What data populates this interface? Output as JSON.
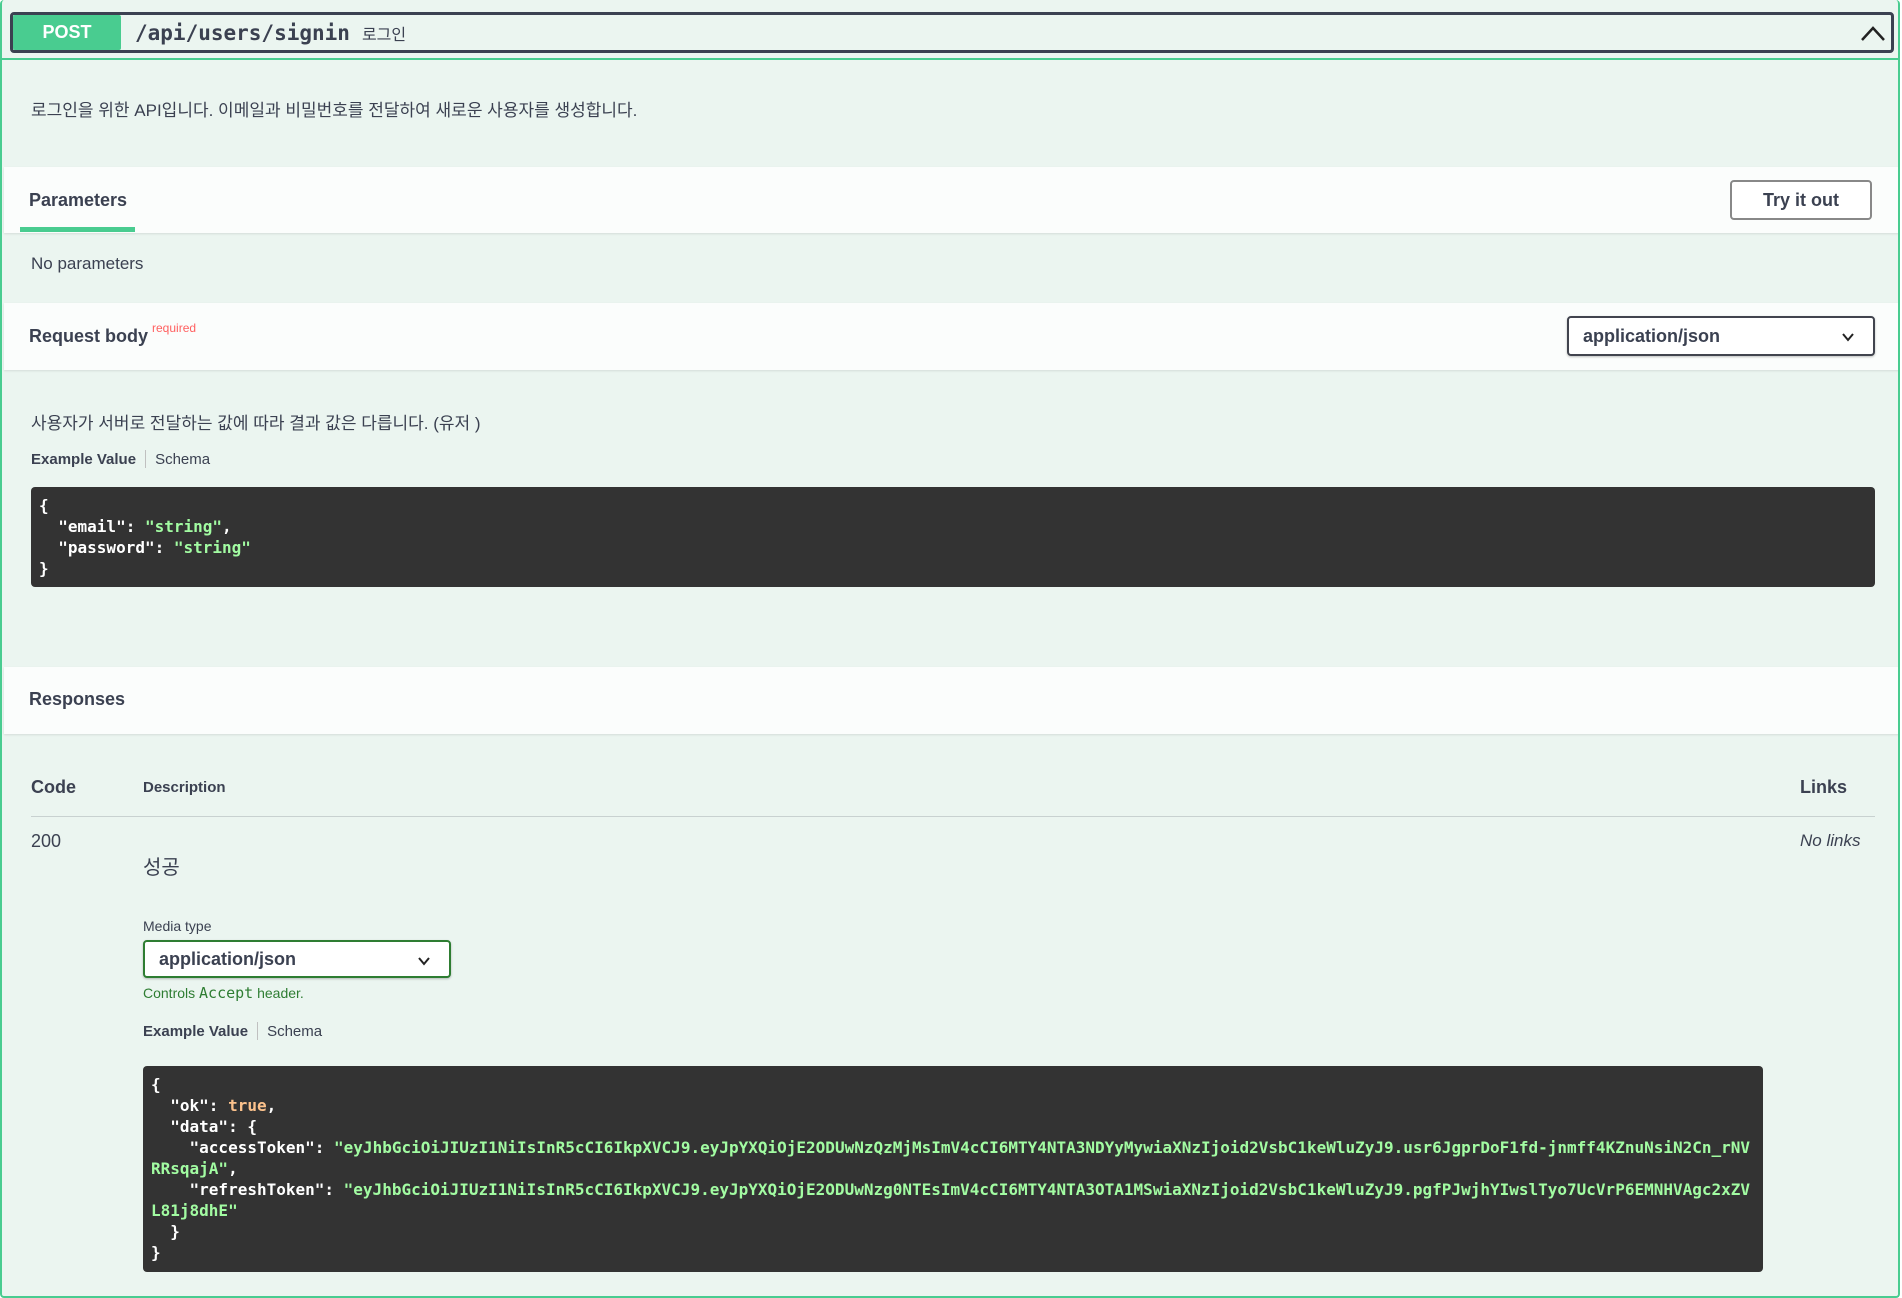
{
  "endpoint": {
    "method": "POST",
    "path": "/api/users/signin",
    "summary": "로그인",
    "description": "로그인을 위한 API입니다. 이메일과 비밀번호를 전달하여 새로운 사용자를 생성합니다."
  },
  "parameters": {
    "tab_label": "Parameters",
    "try_button": "Try it out",
    "empty_text": "No parameters"
  },
  "request_body": {
    "title": "Request body",
    "required_label": "required",
    "content_type": "application/json",
    "description": "사용자가 서버로 전달하는 값에 따라 결과 값은 다릅니다. (유저 )",
    "example_tab": "Example Value",
    "schema_tab": "Schema",
    "example": {
      "open": "{",
      "email_key": "  \"email\": ",
      "email_val": "\"string\"",
      "email_comma": ",",
      "password_key": "  \"password\": ",
      "password_val": "\"string\"",
      "close": "}"
    }
  },
  "responses": {
    "title": "Responses",
    "col_code": "Code",
    "col_description": "Description",
    "col_links": "Links",
    "rows": [
      {
        "code": "200",
        "description": "성공",
        "links": "No links",
        "media_type_label": "Media type",
        "media_type": "application/json",
        "controls_prefix": "Controls ",
        "controls_code": "Accept",
        "controls_suffix": " header.",
        "example_tab": "Example Value",
        "schema_tab": "Schema",
        "example": {
          "l1": "{",
          "ok_key": "  \"ok\": ",
          "ok_val": "true",
          "ok_comma": ",",
          "data_open": "  \"data\": {",
          "access_key": "    \"accessToken\": ",
          "access_val": "\"eyJhbGciOiJIUzI1NiIsInR5cCI6IkpXVCJ9.eyJpYXQiOjE2ODUwNzQzMjMsImV4cCI6MTY4NTA3NDYyMywiaXNzIjoid2VsbC1keWluZyJ9.usr6JgprDoF1fd-jnmff4KZnuNsiN2Cn_rNVRRsqajA\"",
          "access_comma": ",",
          "refresh_key": "    \"refreshToken\": ",
          "refresh_val": "\"eyJhbGciOiJIUzI1NiIsInR5cCI6IkpXVCJ9.eyJpYXQiOjE2ODUwNzg0NTEsImV4cCI6MTY4NTA3OTA1MSwiaXNzIjoid2VsbC1keWluZyJ9.pgfPJwjhYIwslTyo7UcVrP6EMNHVAgc2xZVL81j8dhE\"",
          "data_close": "  }",
          "close": "}"
        }
      }
    ]
  },
  "colors": {
    "post_green": "#49cc90",
    "block_bg": "#ebf5f0",
    "code_bg": "#333333",
    "string_green": "#a2fca2",
    "required_red": "#ff6060"
  },
  "icons": {
    "collapse": "chevron-up-icon",
    "select": "chevron-down-icon"
  }
}
